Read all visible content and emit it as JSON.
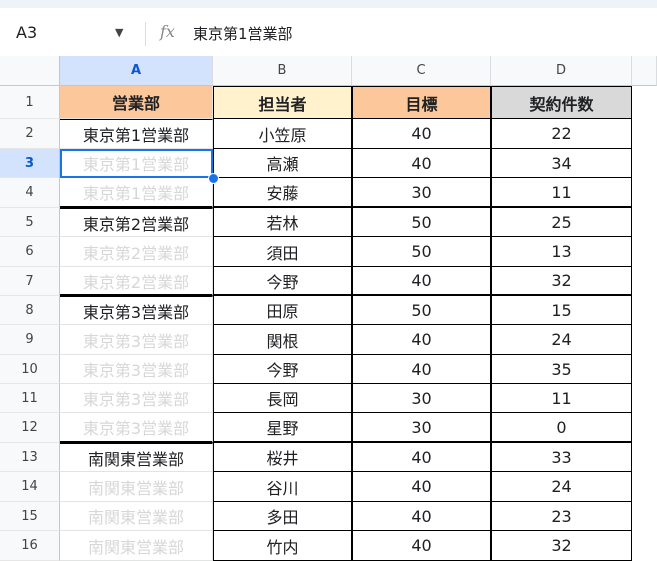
{
  "formula_bar": {
    "cell_ref": "A3",
    "fx_symbol": "fx",
    "content": "東京第1営業部"
  },
  "columns": [
    "A",
    "B",
    "C",
    "D"
  ],
  "selected_column": "A",
  "selected_row": 3,
  "header": {
    "row_number": "1",
    "cells": [
      "営業部",
      "担当者",
      "目標",
      "契約件数"
    ],
    "colors": {
      "orange": "#fcc89b",
      "yellow": "#fff2cc",
      "gray": "#d9d9d9"
    }
  },
  "rows": [
    {
      "num": "2",
      "dept": "東京第1営業部",
      "rep": "小笠原",
      "target": "40",
      "count": "22",
      "faded": false
    },
    {
      "num": "3",
      "dept": "東京第1営業部",
      "rep": "高瀬",
      "target": "40",
      "count": "34",
      "faded": true
    },
    {
      "num": "4",
      "dept": "東京第1営業部",
      "rep": "安藤",
      "target": "30",
      "count": "11",
      "faded": true
    },
    {
      "num": "5",
      "dept": "東京第2営業部",
      "rep": "若林",
      "target": "50",
      "count": "25",
      "faded": false
    },
    {
      "num": "6",
      "dept": "東京第2営業部",
      "rep": "須田",
      "target": "50",
      "count": "13",
      "faded": true
    },
    {
      "num": "7",
      "dept": "東京第2営業部",
      "rep": "今野",
      "target": "40",
      "count": "32",
      "faded": true
    },
    {
      "num": "8",
      "dept": "東京第3営業部",
      "rep": "田原",
      "target": "50",
      "count": "15",
      "faded": false
    },
    {
      "num": "9",
      "dept": "東京第3営業部",
      "rep": "関根",
      "target": "40",
      "count": "24",
      "faded": true
    },
    {
      "num": "10",
      "dept": "東京第3営業部",
      "rep": "今野",
      "target": "40",
      "count": "35",
      "faded": true
    },
    {
      "num": "11",
      "dept": "東京第3営業部",
      "rep": "長岡",
      "target": "30",
      "count": "11",
      "faded": true
    },
    {
      "num": "12",
      "dept": "東京第3営業部",
      "rep": "星野",
      "target": "30",
      "count": "0",
      "faded": true
    },
    {
      "num": "13",
      "dept": "南関東営業部",
      "rep": "桜井",
      "target": "40",
      "count": "33",
      "faded": false
    },
    {
      "num": "14",
      "dept": "南関東営業部",
      "rep": "谷川",
      "target": "40",
      "count": "24",
      "faded": true
    },
    {
      "num": "15",
      "dept": "南関東営業部",
      "rep": "多田",
      "target": "40",
      "count": "23",
      "faded": true
    },
    {
      "num": "16",
      "dept": "南関東営業部",
      "rep": "竹内",
      "target": "40",
      "count": "32",
      "faded": true
    }
  ]
}
